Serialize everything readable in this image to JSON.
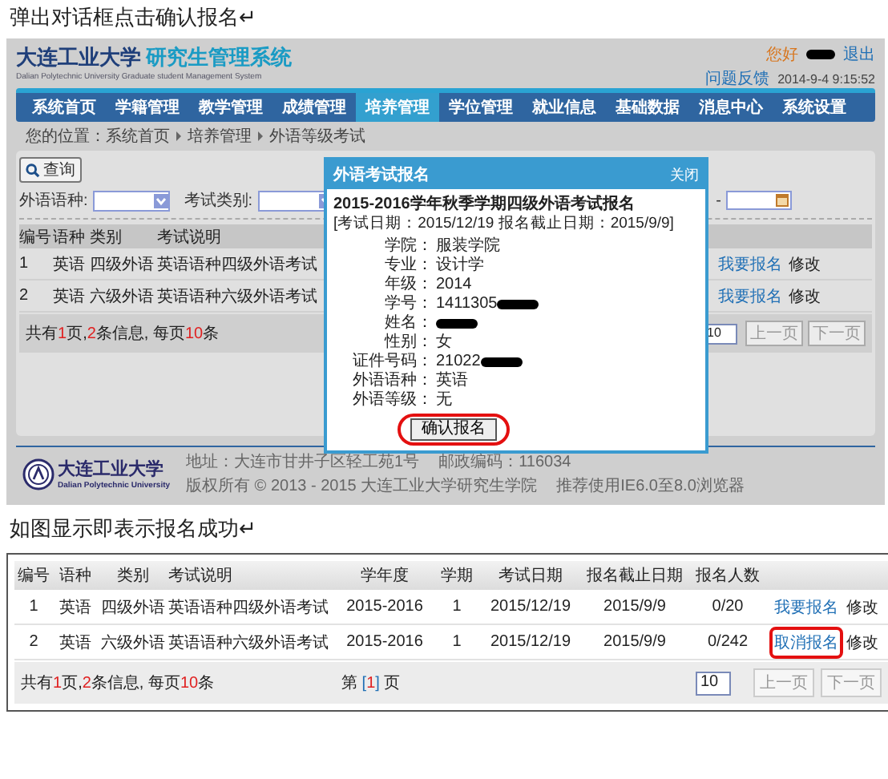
{
  "heading_1": "弹出对话框点击确认报名↵",
  "screenshot_1": {
    "site_title": "大连工业大学",
    "site_subtitle": "研究生管理系统",
    "site_english": "Dalian Polytechnic University Graduate student Management System",
    "greeting": "您好",
    "logout": "退出",
    "feedback": "问题反馈",
    "datetime": "2014-9-4 9:15:52",
    "nav": [
      {
        "label": "系统首页",
        "selected": false
      },
      {
        "label": "学籍管理",
        "selected": false
      },
      {
        "label": "教学管理",
        "selected": false
      },
      {
        "label": "成绩管理",
        "selected": false
      },
      {
        "label": "培养管理",
        "selected": true
      },
      {
        "label": "学位管理",
        "selected": false
      },
      {
        "label": "就业信息",
        "selected": false
      },
      {
        "label": "基础数据",
        "selected": false
      },
      {
        "label": "消息中心",
        "selected": false
      },
      {
        "label": "系统设置",
        "selected": false
      }
    ],
    "breadcrumb": [
      "您的位置：系统首页",
      "培养管理",
      "外语等级考试"
    ],
    "query_button": "查询",
    "filters": [
      {
        "label": "外语语种:"
      },
      {
        "label": "考试类别:"
      }
    ],
    "date_separator": "-",
    "table": {
      "columns": [
        "编号",
        "语种",
        "类别",
        "考试说明"
      ],
      "rows": [
        {
          "cells": [
            "1",
            "英语",
            "四级外语",
            "英语语种四级外语考试"
          ],
          "action": "我要报名",
          "edit": "修改"
        },
        {
          "cells": [
            "2",
            "英语",
            "六级外语",
            "英语语种六级外语考试"
          ],
          "action": "我要报名",
          "edit": "修改"
        }
      ]
    },
    "pager": {
      "summary": [
        {
          "text": "共有",
          "kind": "plain"
        },
        {
          "text": "1",
          "kind": "count"
        },
        {
          "text": "页,",
          "kind": "plain"
        },
        {
          "text": "2",
          "kind": "count"
        },
        {
          "text": "条信息, 每页",
          "kind": "plain"
        },
        {
          "text": "10",
          "kind": "count"
        },
        {
          "text": "条",
          "kind": "plain"
        }
      ],
      "page_size": "10",
      "prev": {
        "label": "上一页",
        "disabled": true
      },
      "next": {
        "label": "下一页",
        "disabled": true
      }
    },
    "dialog": {
      "title": "外语考试报名",
      "close": "关闭",
      "exam_title": "2015-2016学年秋季学期四级外语考试报名",
      "exam_dates": "[考试日期：2015/12/19   报名截止日期：2015/9/9]",
      "fields": [
        {
          "label": "学院：",
          "value": "服装学院",
          "redacted": false
        },
        {
          "label": "专业：",
          "value": "设计学",
          "redacted": false
        },
        {
          "label": "年级：",
          "value": "2014",
          "redacted": false
        },
        {
          "label": "学号：",
          "value": "1411305",
          "redacted": true
        },
        {
          "label": "姓名：",
          "redacted": true
        },
        {
          "label": "性别：",
          "value": "女",
          "redacted": false
        },
        {
          "label": "证件号码：",
          "value": "21022",
          "redacted": true
        },
        {
          "label": "外语语种：",
          "value": "英语",
          "redacted": false
        },
        {
          "label": "外语等级：",
          "value": "无",
          "redacted": false
        }
      ],
      "confirm": {
        "label": "确认报名",
        "circled": true
      }
    },
    "footer": {
      "logo_cn": "大连工业大学",
      "logo_en": "Dalian Polytechnic University",
      "address": "地址：大连市甘井子区轻工苑1号",
      "postcode": "邮政编码：116034",
      "copyright": "版权所有 © 2013 - 2015 大连工业大学研究生学院",
      "browser": "推荐使用IE6.0至8.0浏览器"
    }
  },
  "heading_2": "如图显示即表示报名成功↵",
  "screenshot_2": {
    "columns": [
      "编号",
      "语种",
      "类别",
      "考试说明",
      "学年度",
      "学期",
      "考试日期",
      "报名截止日期",
      "报名人数"
    ],
    "rows": [
      {
        "cells": [
          "1",
          "英语",
          "四级外语",
          "英语语种四级外语考试",
          "2015-2016",
          "1",
          "2015/12/19",
          "2015/9/9",
          "0/20"
        ],
        "action": "我要报名",
        "edit": "修改",
        "circled": false
      },
      {
        "cells": [
          "2",
          "英语",
          "六级外语",
          "英语语种六级外语考试",
          "2015-2016",
          "1",
          "2015/12/19",
          "2015/9/9",
          "0/242"
        ],
        "action": "取消报名",
        "edit": "修改",
        "circled": true
      }
    ],
    "summary": [
      {
        "text": "共有",
        "kind": "plain"
      },
      {
        "text": "1",
        "kind": "count"
      },
      {
        "text": "页,",
        "kind": "plain"
      },
      {
        "text": "2",
        "kind": "count"
      },
      {
        "text": "条信息, 每页",
        "kind": "plain"
      },
      {
        "text": "10",
        "kind": "count"
      },
      {
        "text": "条",
        "kind": "plain"
      }
    ],
    "page_indicator": [
      {
        "text": "第 ",
        "kind": "plain"
      },
      {
        "text": "[",
        "kind": "bracket"
      },
      {
        "text": "1",
        "kind": "count"
      },
      {
        "text": "]",
        "kind": "bracket"
      },
      {
        "text": " 页",
        "kind": "plain"
      }
    ],
    "page_size": "10",
    "prev": {
      "label": "上一页",
      "disabled": true
    },
    "next": {
      "label": "下一页",
      "disabled": true
    }
  }
}
